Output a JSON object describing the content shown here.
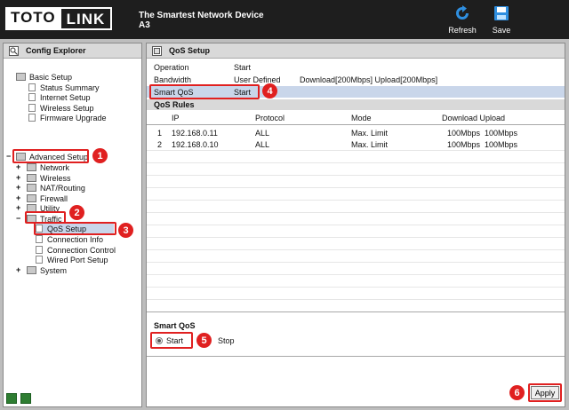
{
  "header": {
    "brand_left": "TOTO",
    "brand_right": "LINK",
    "tagline": "The Smartest Network Device",
    "model": "A3",
    "refresh_label": "Refresh",
    "save_label": "Save"
  },
  "explorer": {
    "title": "Config Explorer",
    "basic_setup": "Basic Setup",
    "basic_children": [
      "Status Summary",
      "Internet Setup",
      "Wireless Setup",
      "Firmware Upgrade"
    ],
    "advanced_setup": "Advanced Setup",
    "advanced_children": [
      "Network",
      "Wireless",
      "NAT/Routing",
      "Firewall",
      "Utility"
    ],
    "traffic": "Traffic",
    "traffic_children": [
      "QoS Setup",
      "Connection Info",
      "Connection Control",
      "Wired Port Setup"
    ],
    "system": "System"
  },
  "qos": {
    "title": "QoS Setup",
    "operation_label": "Operation",
    "operation_value": "Start",
    "bandwidth_label": "Bandwidth",
    "bandwidth_value": "User Defined",
    "bandwidth_detail": "Download[200Mbps] Upload[200Mbps]",
    "smart_qos_label": "Smart QoS",
    "smart_qos_value": "Start",
    "rules_title": "QoS Rules",
    "columns": [
      "IP",
      "Protocol",
      "Mode",
      "Download Upload"
    ],
    "rules": [
      {
        "n": "1",
        "ip": "192.168.0.11",
        "protocol": "ALL",
        "mode": "Max. Limit",
        "down": "100Mbps",
        "up": "100Mbps"
      },
      {
        "n": "2",
        "ip": "192.168.0.10",
        "protocol": "ALL",
        "mode": "Max. Limit",
        "down": "100Mbps",
        "up": "100Mbps"
      }
    ],
    "smart_section": "Smart QoS",
    "opt_start": "Start",
    "opt_stop": "Stop",
    "apply_label": "Apply"
  },
  "annotations": [
    "1",
    "2",
    "3",
    "4",
    "5",
    "6"
  ],
  "colors": {
    "annotation": "#e02020",
    "highlight_row": "#c9d6ea",
    "header_bg": "#1e1e1e"
  }
}
